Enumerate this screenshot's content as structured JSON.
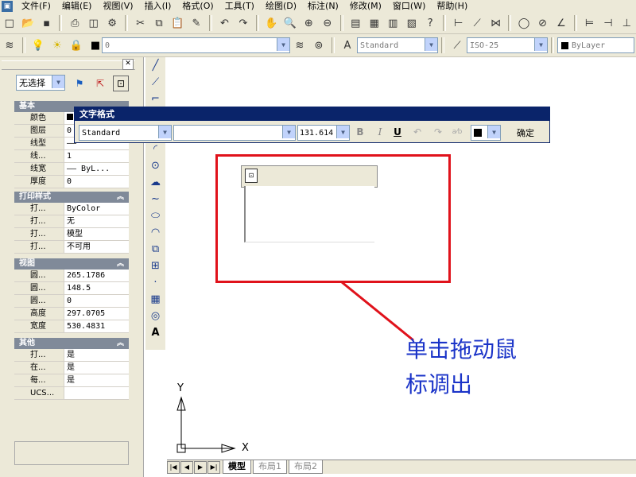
{
  "menubar": {
    "items": [
      "文件(F)",
      "编辑(E)",
      "视图(V)",
      "插入(I)",
      "格式(O)",
      "工具(T)",
      "绘图(D)",
      "标注(N)",
      "修改(M)",
      "窗口(W)",
      "帮助(H)"
    ]
  },
  "toolbar2": {
    "layer_value": "0",
    "text_style": "Standard",
    "dim_style": "ISO-25",
    "linetype": "ByLayer"
  },
  "properties": {
    "selection": "无选择",
    "sections": [
      {
        "title": "基本",
        "rows": [
          {
            "k": "颜色",
            "v": ""
          },
          {
            "k": "图层",
            "v": "0"
          },
          {
            "k": "线型",
            "v": ""
          },
          {
            "k": "线...",
            "v": "1"
          },
          {
            "k": "线宽",
            "v": "—— ByL..."
          },
          {
            "k": "厚度",
            "v": "0"
          }
        ]
      },
      {
        "title": "打印样式",
        "rows": [
          {
            "k": "打...",
            "v": "ByColor"
          },
          {
            "k": "打...",
            "v": "无"
          },
          {
            "k": "打...",
            "v": "模型"
          },
          {
            "k": "打...",
            "v": "不可用"
          }
        ]
      },
      {
        "title": "视图",
        "rows": [
          {
            "k": "圆...",
            "v": "265.1786"
          },
          {
            "k": "圆...",
            "v": "148.5"
          },
          {
            "k": "圆...",
            "v": "0"
          },
          {
            "k": "高度",
            "v": "297.0705"
          },
          {
            "k": "宽度",
            "v": "530.4831"
          }
        ]
      },
      {
        "title": "其他",
        "rows": [
          {
            "k": "打...",
            "v": "是"
          },
          {
            "k": "在...",
            "v": "是"
          },
          {
            "k": "每...",
            "v": "是"
          },
          {
            "k": "UCS...",
            "v": ""
          }
        ]
      }
    ]
  },
  "textformat": {
    "title": "文字格式",
    "style": "Standard",
    "font": "",
    "height": "131.614",
    "bold": "B",
    "italic": "I",
    "underline": "U",
    "ok": "确定"
  },
  "annotation": {
    "line1": "单击拖动鼠",
    "line2": "标调出"
  },
  "ucs": {
    "x": "X",
    "y": "Y"
  },
  "draw_tool_text": "A",
  "tabs": [
    "模型",
    "布局1",
    "布局2"
  ],
  "colors": {
    "highlight": "#e0121b",
    "annotation": "#1b34c8",
    "titlebar": "#0a246a"
  }
}
